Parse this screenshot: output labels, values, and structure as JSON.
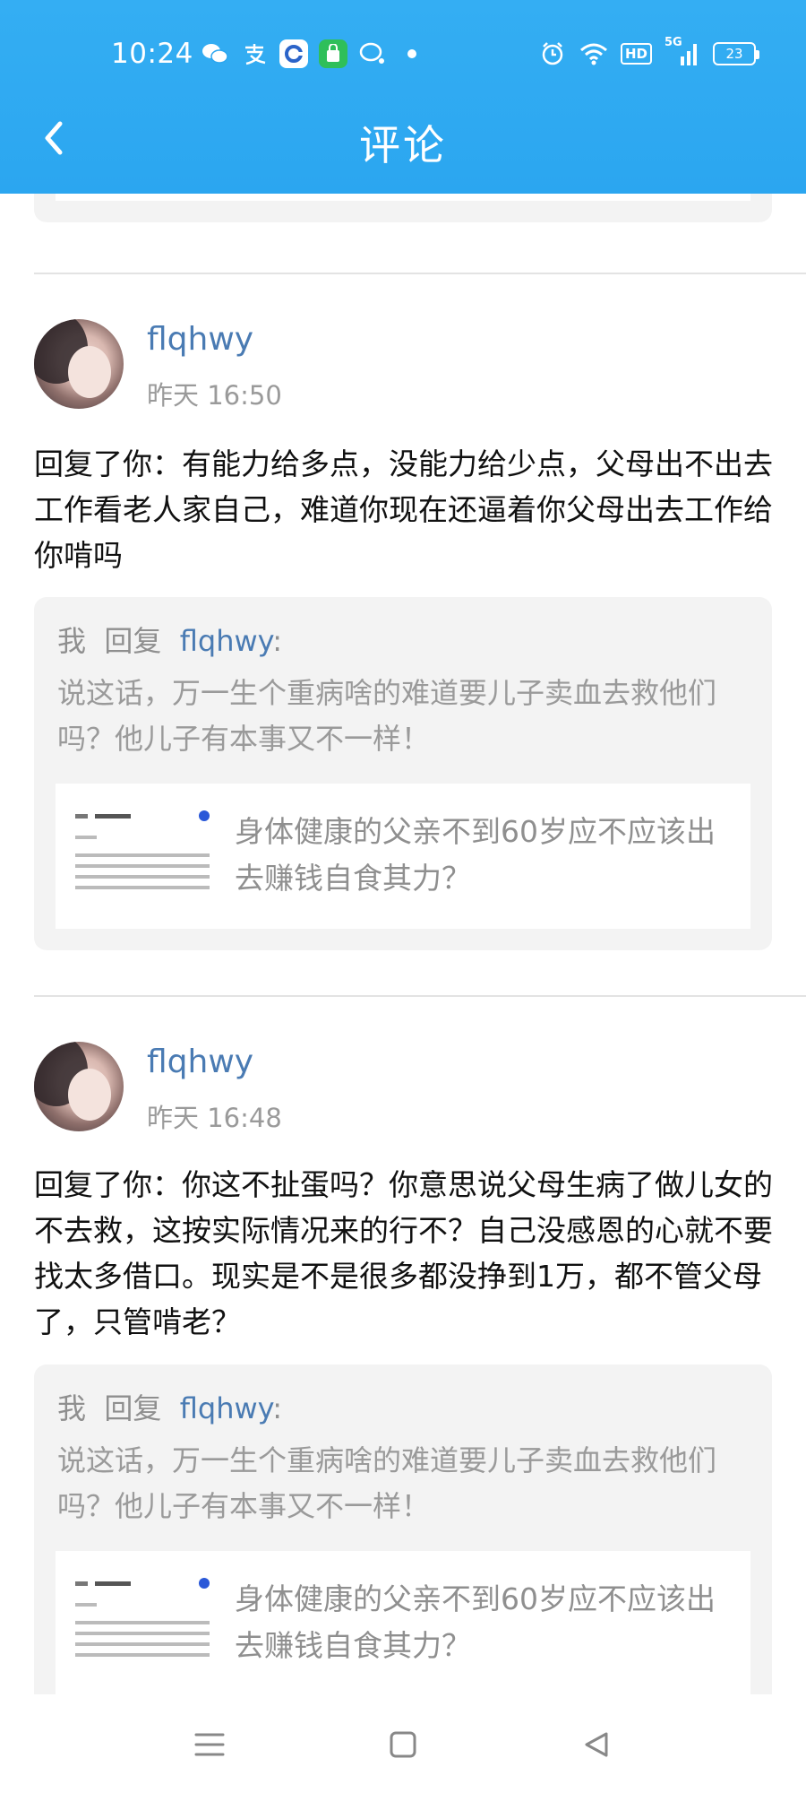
{
  "status_bar": {
    "time": "10:24",
    "battery": "23",
    "hd": "HD",
    "network": "5G"
  },
  "header": {
    "title": "评论",
    "accent": "#2ba6f0"
  },
  "comments": [
    {
      "username": "flqhwy",
      "time": "昨天 16:50",
      "body": "回复了你：有能力给多点，没能力给少点，父母出不出去工作看老人家自己，难道你现在还逼着你父母出去工作给你啃吗",
      "quote": {
        "me": "我",
        "reply_word": "回复",
        "target": "flqhwy",
        "colon": ":",
        "text": "说这话，万一生个重病啥的难道要儿子卖血去救他们吗？他儿子有本事又不一样！"
      },
      "link_title": "身体健康的父亲不到60岁应不应该出去赚钱自食其力？"
    },
    {
      "username": "flqhwy",
      "time": "昨天 16:48",
      "body": "回复了你：你这不扯蛋吗？你意思说父母生病了做儿女的不去救，这按实际情况来的行不？自己没感恩的心就不要找太多借口。现实是不是很多都没挣到1万，都不管父母了，只管啃老？",
      "quote": {
        "me": "我",
        "reply_word": "回复",
        "target": "flqhwy",
        "colon": ":",
        "text": "说这话，万一生个重病啥的难道要儿子卖血去救他们吗？他儿子有本事又不一样！"
      },
      "link_title": "身体健康的父亲不到60岁应不应该出去赚钱自食其力？"
    }
  ],
  "colors": {
    "username": "#4a7bb3",
    "quote_bg": "#f3f3f3",
    "muted": "#9a9a9a"
  }
}
